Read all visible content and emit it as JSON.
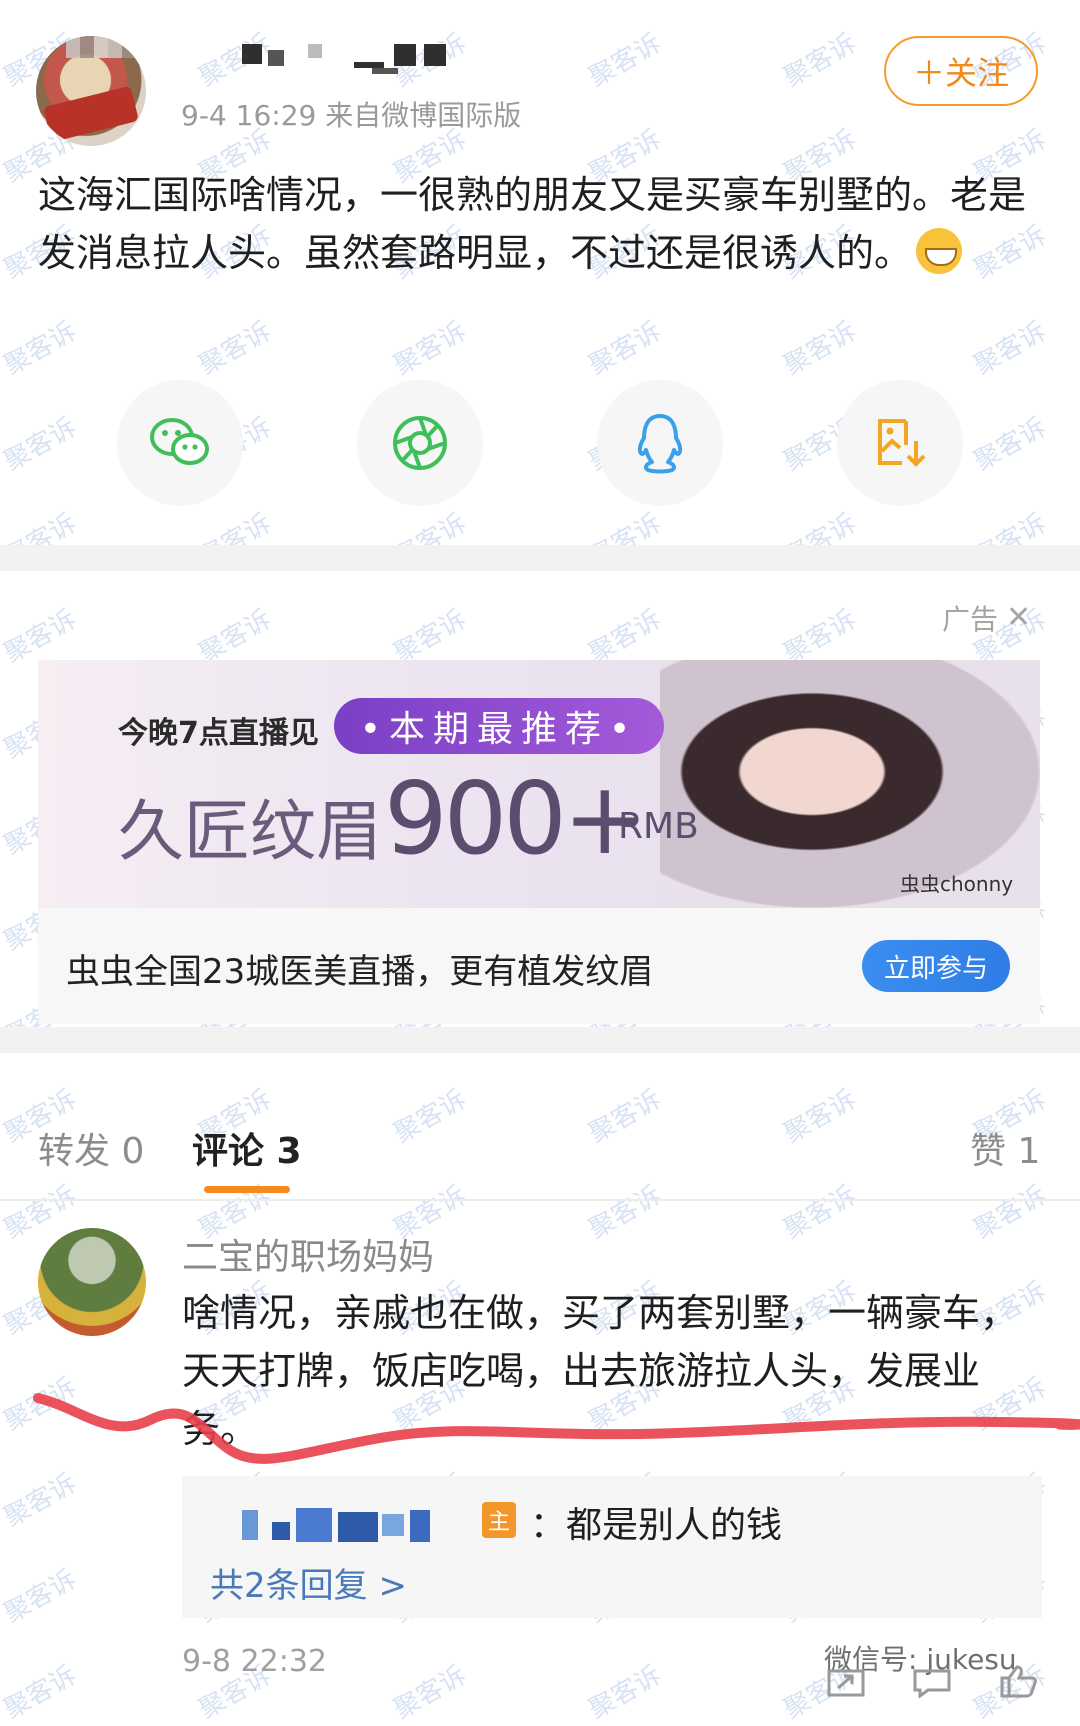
{
  "post": {
    "author_name": "",
    "meta": "9-4 16:29  来自微博国际版",
    "follow_label": "＋关注",
    "text": "这海汇国际啥情况，一很熟的朋友又是买豪车别墅的。老是发消息拉人头。虽然套路明显，不过还是很诱人的。",
    "emoji": "grinning-face"
  },
  "share": {
    "items": [
      "wechat-icon",
      "moments-icon",
      "qq-icon",
      "save-image-icon"
    ]
  },
  "ad": {
    "label": "广告",
    "close": "✕",
    "live_text": "今晚7点直播见",
    "pill_text": "•本期最推荐•",
    "brand_text": "久匠纹眉",
    "price_text": "900+",
    "unit_text": "RMB",
    "model_name": "虫虫chonny",
    "caption": "虫虫全国23城医美直播，更有植发纹眉",
    "cta": "立即参与"
  },
  "tabs": {
    "repost": "转发 0",
    "comment": "评论 3",
    "like": "赞 1"
  },
  "comment": {
    "user": "二宝的职场妈妈",
    "text": "啥情况，亲戚也在做，买了两套别墅，一辆豪车，天天打牌，饭店吃喝，出去旅游拉人头，发展业务。",
    "reply_tag": "主",
    "reply_text": "：都是别人的钱",
    "reply_more": "共2条回复 >",
    "time": "9-8 22:32"
  },
  "watermark": {
    "text": "聚客诉",
    "wechat_id": "微信号: jukesu"
  },
  "colors": {
    "accent_orange": "#f58b1f",
    "link_blue": "#4a79b9",
    "cta_blue": "#2f7de6",
    "highlight_red": "#e8404a",
    "wechat_green": "#3fbf5a",
    "qq_blue": "#3aa0ea",
    "save_orange": "#f2a623"
  }
}
